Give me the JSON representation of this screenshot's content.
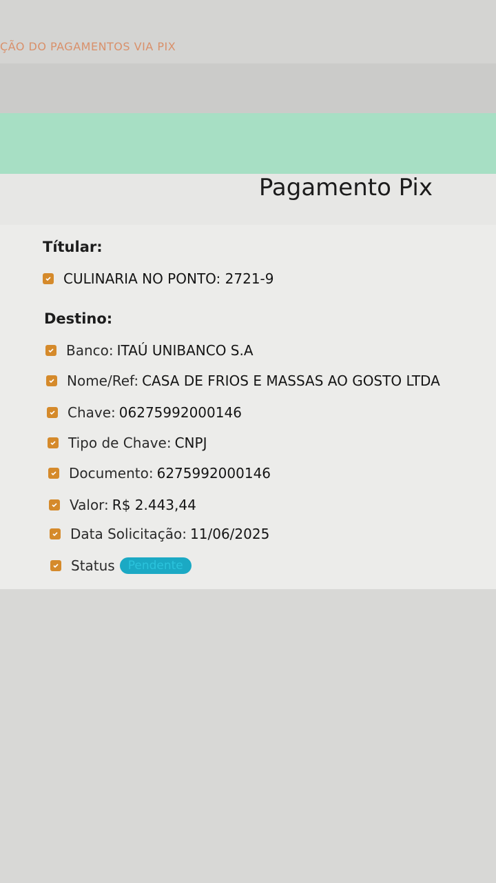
{
  "header": {
    "breadcrumb": "ÇÃO DO PAGAMENTOS VIA PIX"
  },
  "page": {
    "title": "Pagamento Pix"
  },
  "titular": {
    "heading": "Títular:",
    "name": "CULINARIA NO PONTO: 2721-9"
  },
  "destino": {
    "heading": "Destino:",
    "fields": [
      {
        "label": "Banco:",
        "value": "ITAÚ UNIBANCO S.A"
      },
      {
        "label": "Nome/Ref:",
        "value": "CASA DE FRIOS E MASSAS AO GOSTO LTDA"
      },
      {
        "label": "Chave:",
        "value": "06275992000146"
      },
      {
        "label": "Tipo de Chave:",
        "value": "CNPJ"
      },
      {
        "label": "Documento:",
        "value": "6275992000146"
      },
      {
        "label": "Valor:",
        "value": "R$ 2.443,44"
      },
      {
        "label": "Data Solicitação:",
        "value": "11/06/2025"
      }
    ],
    "status": {
      "label": "Status",
      "value": "Pendente"
    }
  },
  "colors": {
    "accent_check": "#d58a2b",
    "banner_green": "#a7dfc4",
    "status_badge": "#1ba9c4"
  }
}
